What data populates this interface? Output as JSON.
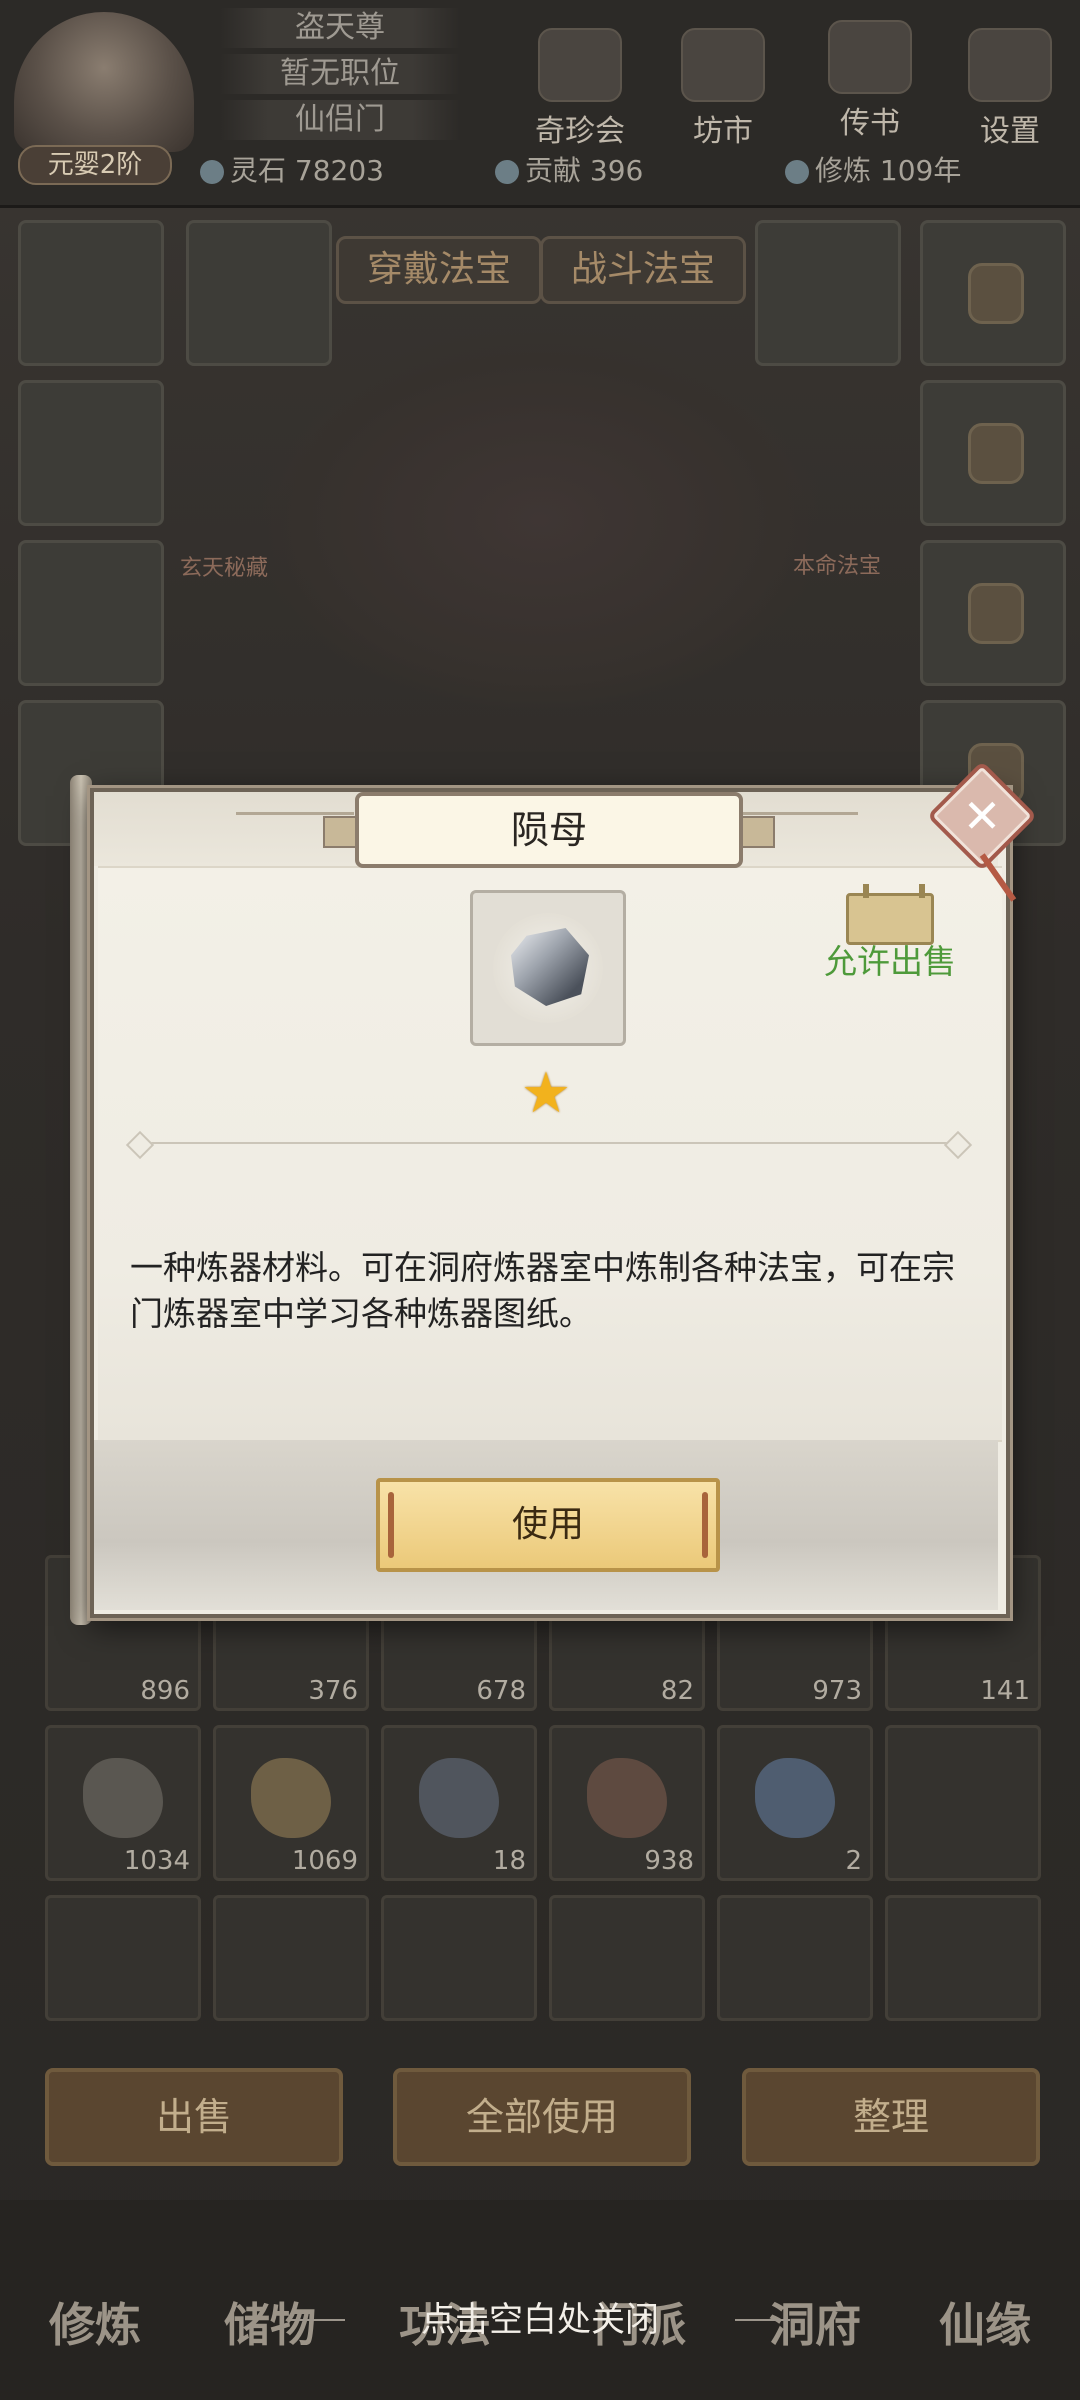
{
  "player": {
    "titles": [
      "盗天尊",
      "暂无职位",
      "仙侣门"
    ],
    "realm": "元婴2阶"
  },
  "top_buttons": [
    "奇珍会",
    "坊市",
    "传书",
    "设置"
  ],
  "resources": {
    "spirit_stone": "灵石 78203",
    "contribution": "贡献 396",
    "cultivation": "修炼 109年"
  },
  "equip_tabs": [
    "穿戴法宝",
    "战斗法宝"
  ],
  "figure_labels": [
    "玄天秘藏",
    "本命法宝"
  ],
  "inventory_counts_row1": [
    "896",
    "376",
    "678",
    "82",
    "973",
    "141"
  ],
  "inventory_counts_row2": [
    "1034",
    "1069",
    "18",
    "938",
    "2"
  ],
  "action_buttons": [
    "出售",
    "全部使用",
    "整理"
  ],
  "nav": [
    "修炼",
    "储物",
    "功法",
    "门派",
    "洞府",
    "仙缘"
  ],
  "close_hint": "点击空白处关闭",
  "modal": {
    "title": "陨母",
    "sell_label": "允许出售",
    "stars": "★",
    "description": "一种炼器材料。可在洞府炼器室中炼制各种法宝，可在宗门炼器室中学习各种炼器图纸。",
    "use_button": "使用"
  }
}
